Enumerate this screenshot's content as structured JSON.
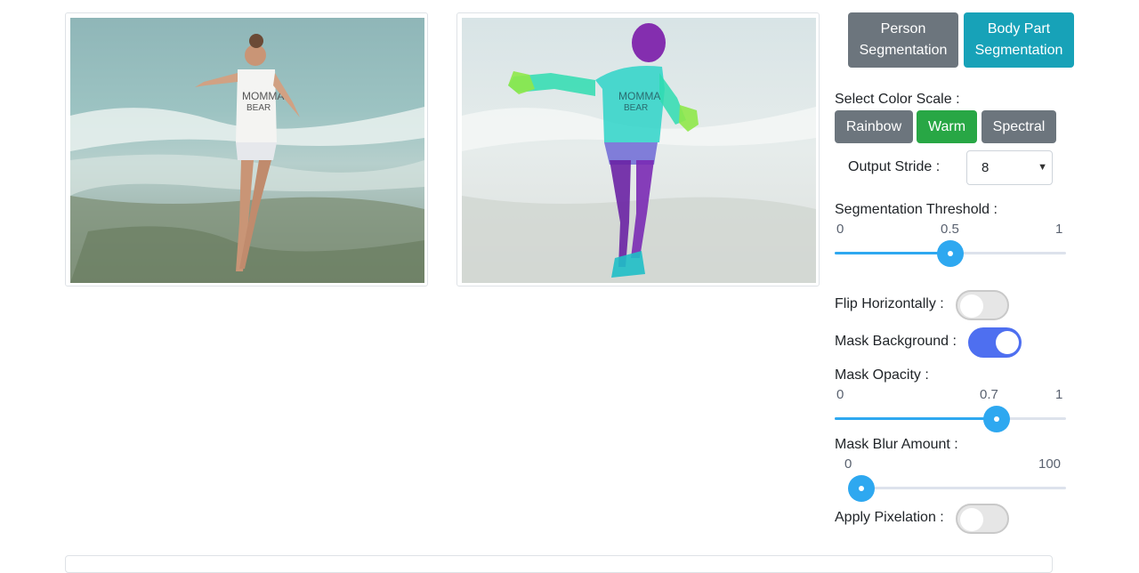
{
  "images": {
    "left": {
      "icon": "photo-icon"
    },
    "right": {
      "icon": "segmentation-overlay-icon"
    }
  },
  "segmentation_buttons": {
    "person": {
      "line1": "Person",
      "line2": "Segmentation"
    },
    "body_part": {
      "line1": "Body Part",
      "line2": "Segmentation"
    }
  },
  "color_scale": {
    "label": "Select Color Scale :",
    "options": [
      "Rainbow",
      "Warm",
      "Spectral"
    ],
    "selected": "Warm"
  },
  "output_stride": {
    "label": "Output Stride :",
    "value": "8"
  },
  "segmentation_threshold": {
    "label": "Segmentation Threshold :",
    "min": "0",
    "max": "1",
    "value": "0.5",
    "fraction": 0.5
  },
  "flip_horizontally": {
    "label": "Flip Horizontally :",
    "on": false
  },
  "mask_background": {
    "label": "Mask Background :",
    "on": true
  },
  "mask_opacity": {
    "label": "Mask Opacity :",
    "min": "0",
    "max": "1",
    "value": "0.7",
    "fraction": 0.7
  },
  "mask_blur": {
    "label": "Mask Blur Amount :",
    "min": "0",
    "max": "100",
    "fraction": 0
  },
  "apply_pixelation": {
    "label": "Apply Pixelation :",
    "on": false
  },
  "colors": {
    "accent_blue": "#2ea8f0",
    "toggle_on": "#4e6ff0",
    "teal": "#17a2b8",
    "green": "#28a745",
    "grey": "#6c757d"
  }
}
